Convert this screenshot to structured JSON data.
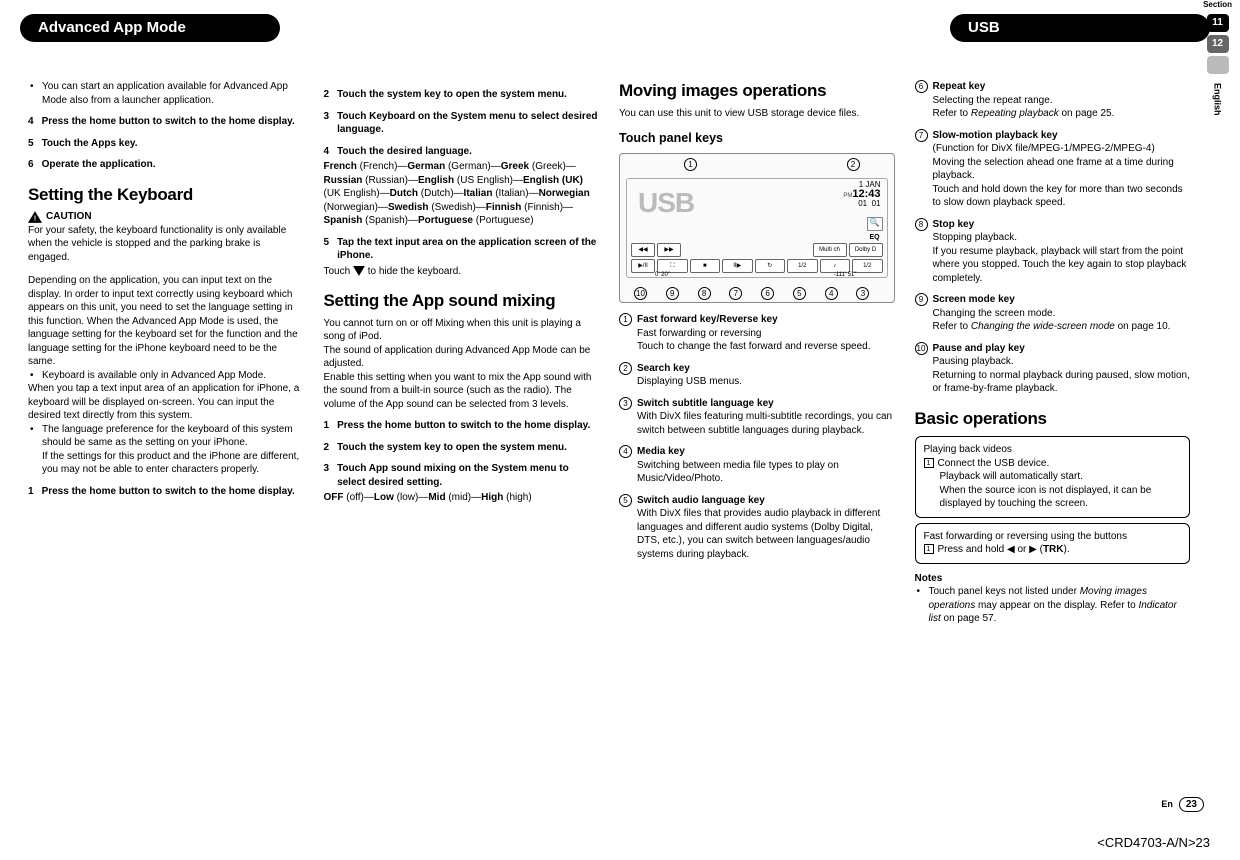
{
  "section": {
    "label": "Section",
    "page1": "11",
    "page2": "12",
    "lang": "English"
  },
  "tabs": {
    "left": "Advanced App Mode",
    "right": "USB"
  },
  "col1": {
    "bullet1": "You can start an application available for Advanced App Mode also from a launcher application.",
    "s4n": "4",
    "s4": "Press the home button to switch to the home display.",
    "s5n": "5",
    "s5": "Touch the Apps key.",
    "s6n": "6",
    "s6": "Operate the application.",
    "h2a": "Setting the Keyboard",
    "caution": "CAUTION",
    "caution_body": "For your safety, the keyboard functionality is only available when the vehicle is stopped and the parking brake is engaged.",
    "para1": "Depending on the application, you can input text on the display. In order to input text correctly using keyboard which appears on this unit, you need to set the language setting in this function. When the Advanced App Mode is used, the language setting for the keyboard set for the function and the language setting for the iPhone keyboard need to be the same.",
    "kb_bullet": "Keyboard is available only in Advanced App Mode.",
    "para2": "When you tap a text input area of an application for iPhone, a keyboard will be displayed on-screen. You can input the desired text directly from this system.",
    "lang_bullet": "The language preference for the keyboard of this system should be same as the setting on your iPhone.",
    "lang_bullet2": "If the settings for this product and the iPhone are different, you may not be able to enter characters properly.",
    "s1n": "1",
    "s1": "Press the home button to switch to the home display."
  },
  "col2": {
    "s2n": "2",
    "s2": "Touch the system key to open the system menu.",
    "s3n": "3",
    "s3": "Touch Keyboard on the System menu to select desired language.",
    "s4n": "4",
    "s4": "Touch the desired language.",
    "langs": "French (French)—German (German)—Greek (Greek)—Russian (Russian)—English (US English)—English (UK) (UK English)—Dutch (Dutch)—Italian (Italian)—Norwegian (Norwegian)—Swedish (Swedish)—Finnish (Finnish)—Spanish (Spanish)—Portuguese (Portuguese)",
    "s5n": "5",
    "s5": "Tap the text input area on the application screen of the iPhone.",
    "s5b": "Touch ",
    "s5c": " to hide the keyboard.",
    "h2b": "Setting the App sound mixing",
    "mix1": "You cannot turn on or off Mixing when this unit is playing a song of iPod.",
    "mix2": "The sound of application during Advanced App Mode can be adjusted.",
    "mix3": "Enable this setting when you want to mix the App sound with the sound from a built-in source (such as the radio). The volume of the App sound can be selected from 3 levels.",
    "m1n": "1",
    "m1": "Press the home button to switch to the home display.",
    "m2n": "2",
    "m2": "Touch the system key to open the system menu.",
    "m3n": "3",
    "m3": "Touch App sound mixing on the System menu to select desired setting.",
    "m3b": "OFF (off)—Low (low)—Mid (mid)—High (high)"
  },
  "col3": {
    "h2a": "Moving images operations",
    "intro": "You can use this unit to view USB storage device files.",
    "h3a": "Touch panel keys",
    "callouts_top": [
      "1",
      "2"
    ],
    "callouts_bottom": [
      "10",
      "9",
      "8",
      "7",
      "6",
      "5",
      "4",
      "3"
    ],
    "usb_label": "USB",
    "clock_date": "1 JAN",
    "clock_pm": "PM",
    "clock_time": "12:43",
    "clock_sub1": "01",
    "clock_sub2": "01",
    "btn_rew": "◀◀",
    "btn_ff": "▶▶",
    "btn_multi": "Multi ch",
    "btn_dolby": "Dolby D",
    "btn_play": "▶/II",
    "btn_stop": "■",
    "btn_slow": "II▶",
    "btn_sub": "1/2",
    "btn_audio": "1/2",
    "btn_media": "♪",
    "btn_repeat": "↻",
    "time_l": "0' 20\"",
    "time_r": "-111' 51\"",
    "eq": "EQ",
    "star": "★",
    "search_icon": "🔍",
    "k1": {
      "n": "1",
      "t": "Fast forward key/Reverse key",
      "d1": "Fast forwarding or reversing",
      "d2": "Touch to change the fast forward and reverse speed."
    },
    "k2": {
      "n": "2",
      "t": "Search key",
      "d1": "Displaying USB menus."
    },
    "k3": {
      "n": "3",
      "t": "Switch subtitle language key",
      "d1": "With DivX files featuring multi-subtitle recordings, you can switch between subtitle languages during playback."
    },
    "k4": {
      "n": "4",
      "t": "Media key",
      "d1": "Switching between media file types to play on Music/Video/Photo."
    },
    "k5": {
      "n": "5",
      "t": "Switch audio language key",
      "d1": "With DivX files that provides audio playback in different languages and different audio systems (Dolby Digital, DTS, etc.), you can switch between languages/audio systems during playback."
    }
  },
  "col4": {
    "k6": {
      "n": "6",
      "t": "Repeat key",
      "d1": "Selecting the repeat range.",
      "d2a": "Refer to ",
      "d2b": "Repeating playback",
      "d2c": " on page 25."
    },
    "k7": {
      "n": "7",
      "t": "Slow-motion playback key",
      "d1": "(Function for DivX file/MPEG-1/MPEG-2/MPEG-4)",
      "d2": "Moving the selection ahead one frame at a time during playback.",
      "d3": "Touch and hold down the key for more than two seconds to slow down playback speed."
    },
    "k8": {
      "n": "8",
      "t": "Stop key",
      "d1": "Stopping playback.",
      "d2": "If you resume playback, playback will start from the point where you stopped. Touch the key again to stop playback completely."
    },
    "k9": {
      "n": "9",
      "t": "Screen mode key",
      "d1": "Changing the screen mode.",
      "d2a": "Refer to ",
      "d2b": "Changing the wide-screen mode",
      "d2c": " on page 10."
    },
    "k10": {
      "n": "10",
      "t": "Pause and play key",
      "d1": "Pausing playback.",
      "d2": "Returning to normal playback during paused, slow motion, or frame-by-frame playback."
    },
    "h2b": "Basic operations",
    "box1_t": "Playing back videos",
    "box1_n": "1",
    "box1_a": "Connect the USB device.",
    "box1_b": "Playback will automatically start.",
    "box1_c": "When the source icon is not displayed, it can be displayed by touching the screen.",
    "box2_t": "Fast forwarding or reversing using the buttons",
    "box2_n": "1",
    "box2_a": "Press and hold ◀ or ▶ (",
    "box2_trk": "TRK",
    "box2_b": ").",
    "notes_h": "Notes",
    "note1a": "Touch panel keys not listed under ",
    "note1b": "Moving images operations",
    "note1c": " may appear on the display. Refer to ",
    "note1d": "Indicator list",
    "note1e": " on page 57."
  },
  "footer": {
    "lang": "En",
    "page": "23",
    "code": "<CRD4703-A/N>23"
  }
}
